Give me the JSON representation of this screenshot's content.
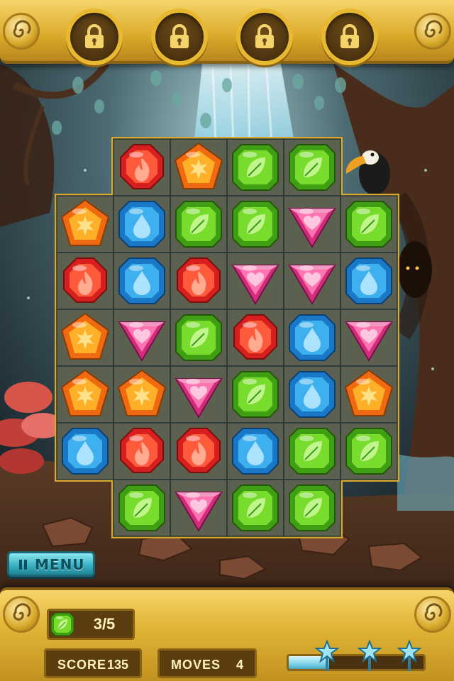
{
  "hud": {
    "locks": [
      {
        "icon": "padlock-icon",
        "state": "locked"
      },
      {
        "icon": "padlock-icon",
        "state": "locked"
      },
      {
        "icon": "padlock-icon",
        "state": "locked"
      },
      {
        "icon": "padlock-icon",
        "state": "locked"
      }
    ]
  },
  "menu": {
    "label": "MENU",
    "icon": "pause-icon"
  },
  "goal": {
    "gem": "green",
    "count_text": "3/5"
  },
  "stats": {
    "score_label": "SCORE",
    "score_value": "135",
    "moves_label": "MOVES",
    "moves_value": "4"
  },
  "progress": {
    "fill_fraction": 0.3,
    "stars": 3
  },
  "gem_types": {
    "R": {
      "name": "red-fire-gem",
      "icon": "flame"
    },
    "O": {
      "name": "orange-star-gem",
      "icon": "star"
    },
    "G": {
      "name": "green-leaf-gem",
      "icon": "leaf"
    },
    "B": {
      "name": "blue-drop-gem",
      "icon": "droplet"
    },
    "P": {
      "name": "pink-heart-gem",
      "icon": "heart"
    }
  },
  "board": {
    "rows": [
      [
        "",
        "R",
        "O",
        "G",
        "G",
        ""
      ],
      [
        "O",
        "B",
        "G",
        "G",
        "P",
        "G"
      ],
      [
        "R",
        "B",
        "R",
        "P",
        "P",
        "B"
      ],
      [
        "O",
        "P",
        "G",
        "R",
        "B",
        "P"
      ],
      [
        "O",
        "O",
        "P",
        "G",
        "B",
        "O"
      ],
      [
        "B",
        "R",
        "R",
        "B",
        "G",
        "G"
      ],
      [
        "",
        "G",
        "P",
        "G",
        "G",
        ""
      ]
    ]
  },
  "colors": {
    "gold": "#e8b830",
    "board_frame": "#d9a92a",
    "tile": "#3f4f58",
    "menu": "#3ab3c4"
  }
}
